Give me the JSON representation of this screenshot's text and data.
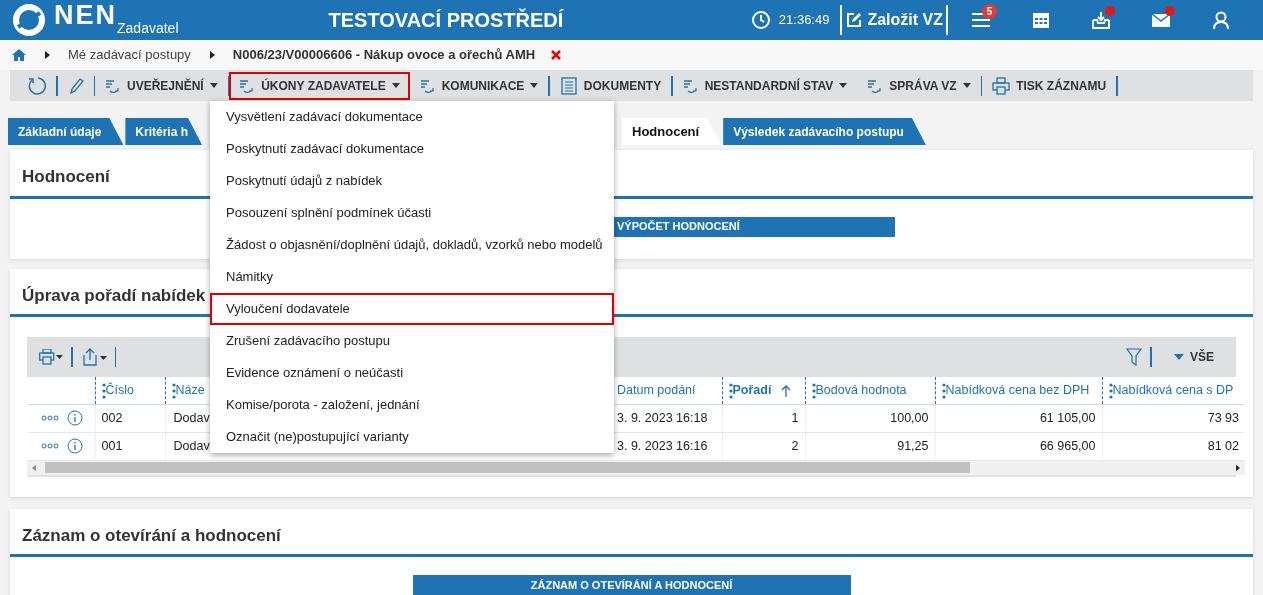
{
  "header": {
    "logo": "NEN",
    "subtitle": "Zadavatel",
    "environment": "TESTOVACÍ PROSTŘEDÍ",
    "time": "21:36:49",
    "create_button": "Založit VZ",
    "menu_badge": "5",
    "icons": [
      {
        "kind": "calendar",
        "notification": false
      },
      {
        "kind": "inbox",
        "notification": true
      },
      {
        "kind": "mail",
        "notification": true
      },
      {
        "kind": "user",
        "notification": false
      }
    ]
  },
  "breadcrumb": [
    {
      "label": "Mé zadávací postupy",
      "current": false
    },
    {
      "label": "N006/23/V00006606 - Nákup ovoce a ořechů AMH",
      "current": true
    }
  ],
  "toolbar": [
    {
      "kind": "refresh",
      "highlighted": false
    },
    {
      "kind": "edit",
      "highlighted": false
    },
    {
      "kind": "menu",
      "label": "UVEŘEJNĚNÍ",
      "highlighted": false
    },
    {
      "kind": "menu",
      "label": "ÚKONY ZADAVATELE",
      "highlighted": true
    },
    {
      "kind": "menu",
      "label": "KOMUNIKACE",
      "highlighted": false
    },
    {
      "kind": "document",
      "label": "DOKUMENTY",
      "highlighted": false
    },
    {
      "kind": "menu",
      "label": "NESTANDARDNÍ STAV",
      "highlighted": false
    },
    {
      "kind": "menu",
      "label": "SPRÁVA VZ",
      "highlighted": false
    },
    {
      "kind": "print",
      "label": "TISK ZÁZNAMU",
      "highlighted": false
    }
  ],
  "dropdown": [
    {
      "label": "Vysvětlení zadávací dokumentace",
      "highlighted": false
    },
    {
      "label": "Poskytnutí zadávací dokumentace",
      "highlighted": false
    },
    {
      "label": "Poskytnutí údajů z nabídek",
      "highlighted": false
    },
    {
      "label": "Posouzení splnění podmínek účasti",
      "highlighted": false
    },
    {
      "label": "Žádost o objasnění/doplnění údajů, dokladů, vzorků nebo modelů",
      "highlighted": false
    },
    {
      "label": "Námitky",
      "highlighted": false
    },
    {
      "label": "Vyloučení dodavatele",
      "highlighted": true
    },
    {
      "label": "Zrušení zadávacího postupu",
      "highlighted": false
    },
    {
      "label": "Evidence oznámení o neúčasti",
      "highlighted": false
    },
    {
      "label": "Komise/porota - založení, jednání",
      "highlighted": false
    },
    {
      "label": "Označit (ne)postupující varianty",
      "highlighted": false
    }
  ],
  "tabs": [
    {
      "label": "Základní údaje",
      "selected": false
    },
    {
      "label": "Kritéria h",
      "selected": false
    },
    {
      "label": "Hodnocení",
      "selected": true
    },
    {
      "label": "Výsledek zadávacího postupu",
      "selected": false
    }
  ],
  "sections": [
    {
      "kind": "button",
      "title": "Hodnocení",
      "button": "VÝPOČET HODNOCENÍ"
    },
    {
      "kind": "table",
      "title": "Úprava pořadí nabídek",
      "table": {
        "filter_label": "VŠE",
        "columns": [
          {
            "label": "Číslo",
            "handle": true,
            "numeric": false,
            "sorted": false
          },
          {
            "label": "Náze",
            "handle": true,
            "numeric": false,
            "sorted": false
          },
          {
            "label": "Datum podání",
            "handle": false,
            "numeric": false,
            "sorted": false
          },
          {
            "label": "Pořadí",
            "handle": true,
            "numeric": true,
            "sorted": true
          },
          {
            "label": "Bodová hodnota",
            "handle": true,
            "numeric": true,
            "sorted": false
          },
          {
            "label": "Nabídková cena bez DPH",
            "handle": true,
            "numeric": true,
            "sorted": false
          },
          {
            "label": "Nabídková cena s DP",
            "handle": true,
            "numeric": true,
            "sorted": false
          }
        ],
        "rows": [
          [
            "002",
            "Dodav",
            "3. 9. 2023 16:18",
            "1",
            "100,00",
            "61 105,00",
            "73 93"
          ],
          [
            "001",
            "Dodav",
            "3. 9. 2023 16:16",
            "2",
            "91,25",
            "66 965,00",
            "81 02"
          ]
        ]
      }
    },
    {
      "kind": "button",
      "title": "Záznam o otevírání a hodnocení",
      "button": "ZÁZNAM O OTEVÍRÁNÍ A HODNOCENÍ"
    }
  ]
}
